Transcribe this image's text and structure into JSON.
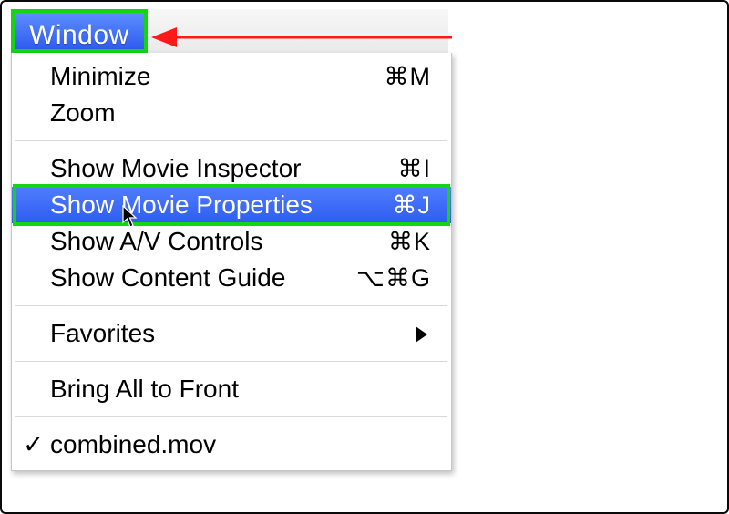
{
  "menubar": {
    "title": "Window"
  },
  "menu": {
    "minimize": {
      "label": "Minimize",
      "shortcut": "⌘M"
    },
    "zoom": {
      "label": "Zoom"
    },
    "inspector": {
      "label": "Show Movie Inspector",
      "shortcut": "⌘I"
    },
    "properties": {
      "label": "Show Movie Properties",
      "shortcut": "⌘J"
    },
    "av": {
      "label": "Show A/V Controls",
      "shortcut": "⌘K"
    },
    "guide": {
      "label": "Show Content Guide",
      "shortcut": "⌥⌘G"
    },
    "favorites": {
      "label": "Favorites"
    },
    "bringfront": {
      "label": "Bring All to Front"
    },
    "doc": {
      "label": "combined.mov"
    }
  }
}
